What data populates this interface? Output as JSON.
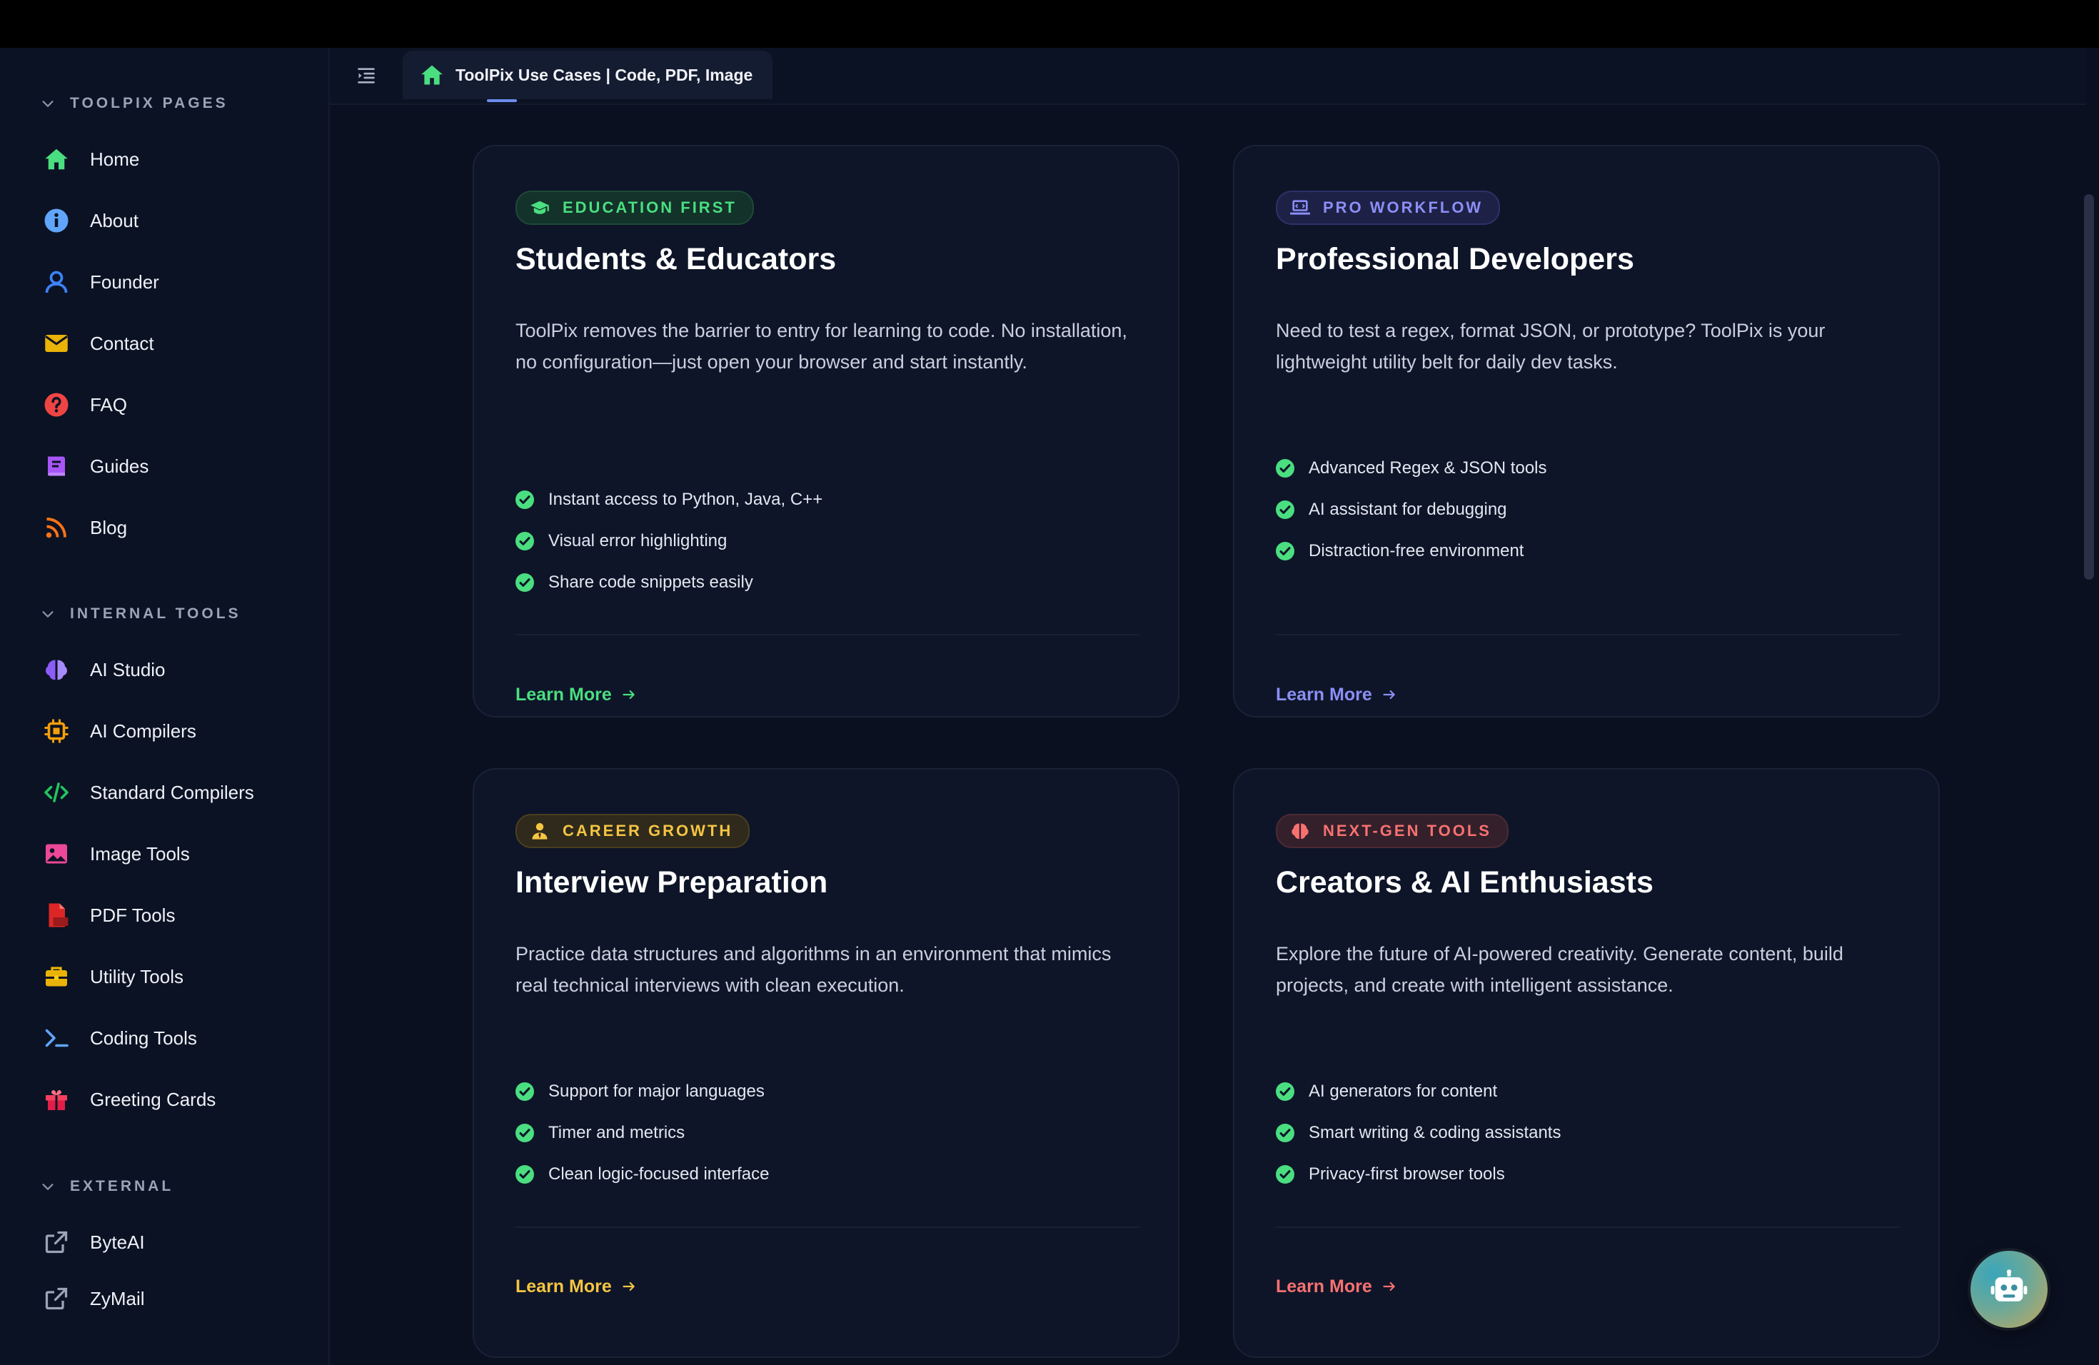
{
  "window": {
    "tab_title": "ToolPix Use Cases | Code, PDF, Image"
  },
  "sidebar": {
    "sections": [
      {
        "title": "TOOLPIX PAGES",
        "items": [
          {
            "label": "Home",
            "icon": "home-icon"
          },
          {
            "label": "About",
            "icon": "info-icon"
          },
          {
            "label": "Founder",
            "icon": "user-icon"
          },
          {
            "label": "Contact",
            "icon": "envelope-icon"
          },
          {
            "label": "FAQ",
            "icon": "question-icon"
          },
          {
            "label": "Guides",
            "icon": "book-icon"
          },
          {
            "label": "Blog",
            "icon": "rss-icon"
          }
        ]
      },
      {
        "title": "INTERNAL TOOLS",
        "items": [
          {
            "label": "AI Studio",
            "icon": "brain-icon"
          },
          {
            "label": "AI Compilers",
            "icon": "chip-icon"
          },
          {
            "label": "Standard Compilers",
            "icon": "code-icon"
          },
          {
            "label": "Image Tools",
            "icon": "image-icon"
          },
          {
            "label": "PDF Tools",
            "icon": "pdf-file-icon"
          },
          {
            "label": "Utility Tools",
            "icon": "toolbox-icon"
          },
          {
            "label": "Coding Tools",
            "icon": "terminal-icon"
          },
          {
            "label": "Greeting Cards",
            "icon": "gift-icon"
          }
        ]
      },
      {
        "title": "EXTERNAL",
        "items": [
          {
            "label": "ByteAI",
            "icon": "external-link-icon"
          },
          {
            "label": "ZyMail",
            "icon": "external-link-icon"
          }
        ]
      }
    ]
  },
  "cards": [
    {
      "badge": "EDUCATION FIRST",
      "badge_icon": "graduation-cap-icon",
      "accent": "#4ade80",
      "title": "Students & Educators",
      "description": "ToolPix removes the barrier to entry for learning to code. No installation, no configuration—just open your browser and start instantly.",
      "features": [
        "Instant access to Python, Java, C++",
        "Visual error highlighting",
        "Share code snippets easily"
      ],
      "cta": "Learn More"
    },
    {
      "badge": "PRO WORKFLOW",
      "badge_icon": "laptop-icon",
      "accent": "#8b8ff5",
      "title": "Professional Developers",
      "description": "Need to test a regex, format JSON, or prototype? ToolPix is your lightweight utility belt for daily dev tasks.",
      "features": [
        "Advanced Regex & JSON tools",
        "AI assistant for debugging",
        "Distraction-free environment"
      ],
      "cta": "Learn More"
    },
    {
      "badge": "CAREER GROWTH",
      "badge_icon": "user-tie-icon",
      "accent": "#f5c542",
      "title": "Interview Preparation",
      "description": "Practice data structures and algorithms in an environment that mimics real technical interviews with clean execution.",
      "features": [
        "Support for major languages",
        "Timer and metrics",
        "Clean logic-focused interface"
      ],
      "cta": "Learn More"
    },
    {
      "badge": "NEXT-GEN TOOLS",
      "badge_icon": "brain-icon",
      "accent": "#f87171",
      "title": "Creators & AI Enthusiasts",
      "description": "Explore the future of AI-powered creativity. Generate content, build projects, and create with intelligent assistance.",
      "features": [
        "AI generators for content",
        "Smart writing & coding assistants",
        "Privacy-first browser tools"
      ],
      "cta": "Learn More"
    }
  ],
  "chat_button": {
    "icon": "robot-icon"
  }
}
